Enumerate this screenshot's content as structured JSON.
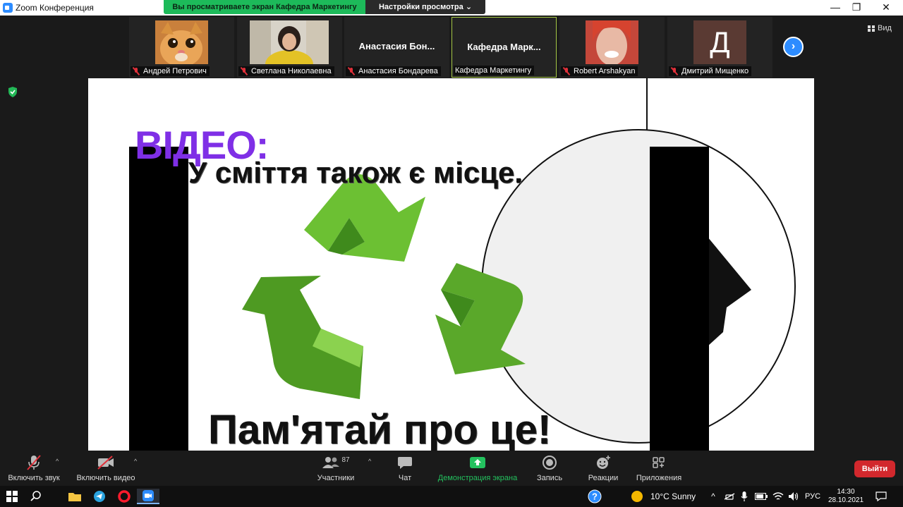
{
  "window": {
    "title": "Zoom Конференция",
    "minimize": "—",
    "restore": "❐",
    "close": "✕"
  },
  "share_banner": {
    "text": "Вы просматриваете экран Кафедра Маркетингу",
    "view_options": "Настройки просмотра ⌄"
  },
  "participants": [
    {
      "name": "Андрей Петрович",
      "kind": "photo-cat"
    },
    {
      "name": "Светлана Николаевна",
      "kind": "photo-woman"
    },
    {
      "name": "Анастасия Бондарева",
      "display": "Анастасия Бон..."
    },
    {
      "name": "Кафедра Маркетингу",
      "display": "Кафедра Марк...",
      "active": true
    },
    {
      "name": "Robert Arshakyan",
      "kind": "photo-redhead"
    },
    {
      "name": "Дмитрий Мищенко",
      "initial": "Д"
    }
  ],
  "view_button": "Вид",
  "slide": {
    "title": "ВІДЕО:",
    "top_text": "У сміття також є місце.",
    "bottom_text": "Пам'ятай про це!",
    "title_color": "#7f2fe6",
    "recycle_color": "#5aa82a"
  },
  "toolbar": {
    "unmute": "Включить звук",
    "start_video": "Включить видео",
    "participants": "Участники",
    "participants_count": "87",
    "chat": "Чат",
    "share_screen": "Демонстрация экрана",
    "record": "Запись",
    "reactions": "Реакции",
    "apps": "Приложения",
    "leave": "Выйти"
  },
  "taskbar": {
    "weather": "10°C  Sunny",
    "language": "РУС",
    "time": "14:30",
    "date": "28.10.2021"
  }
}
